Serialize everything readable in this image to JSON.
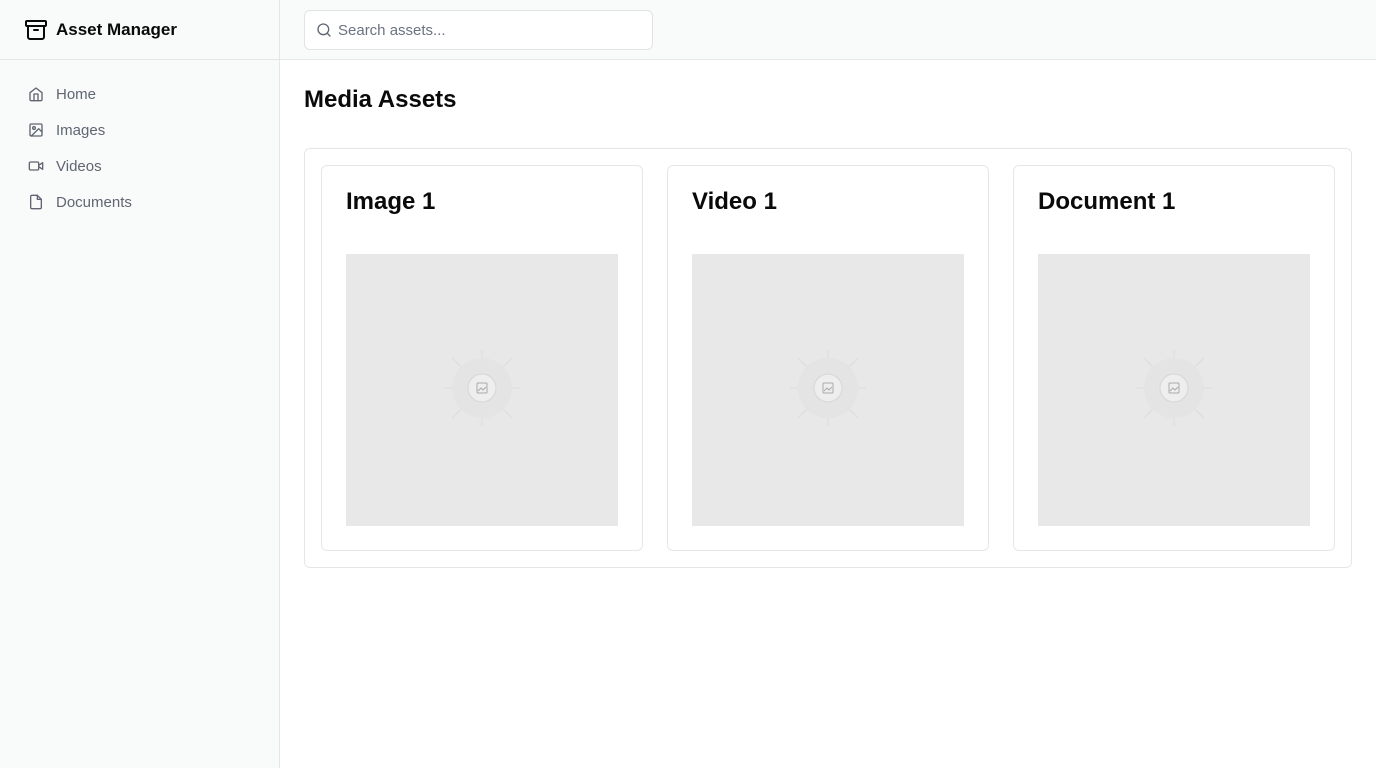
{
  "app": {
    "title": "Asset Manager",
    "logo_icon": "archive-icon"
  },
  "sidebar": {
    "items": [
      {
        "label": "Home",
        "icon": "home-icon"
      },
      {
        "label": "Images",
        "icon": "image-icon"
      },
      {
        "label": "Videos",
        "icon": "video-icon"
      },
      {
        "label": "Documents",
        "icon": "file-icon"
      }
    ]
  },
  "search": {
    "placeholder": "Search assets...",
    "value": ""
  },
  "main": {
    "title": "Media Assets",
    "assets": [
      {
        "title": "Image 1",
        "thumbnail_icon": "image-placeholder-icon"
      },
      {
        "title": "Video 1",
        "thumbnail_icon": "image-placeholder-icon"
      },
      {
        "title": "Document 1",
        "thumbnail_icon": "image-placeholder-icon"
      }
    ]
  },
  "colors": {
    "sidebar_bg": "#f9fafa",
    "border": "#e4e6e8",
    "muted_text": "#5f6672",
    "thumbnail_bg": "#e8e8e8"
  }
}
